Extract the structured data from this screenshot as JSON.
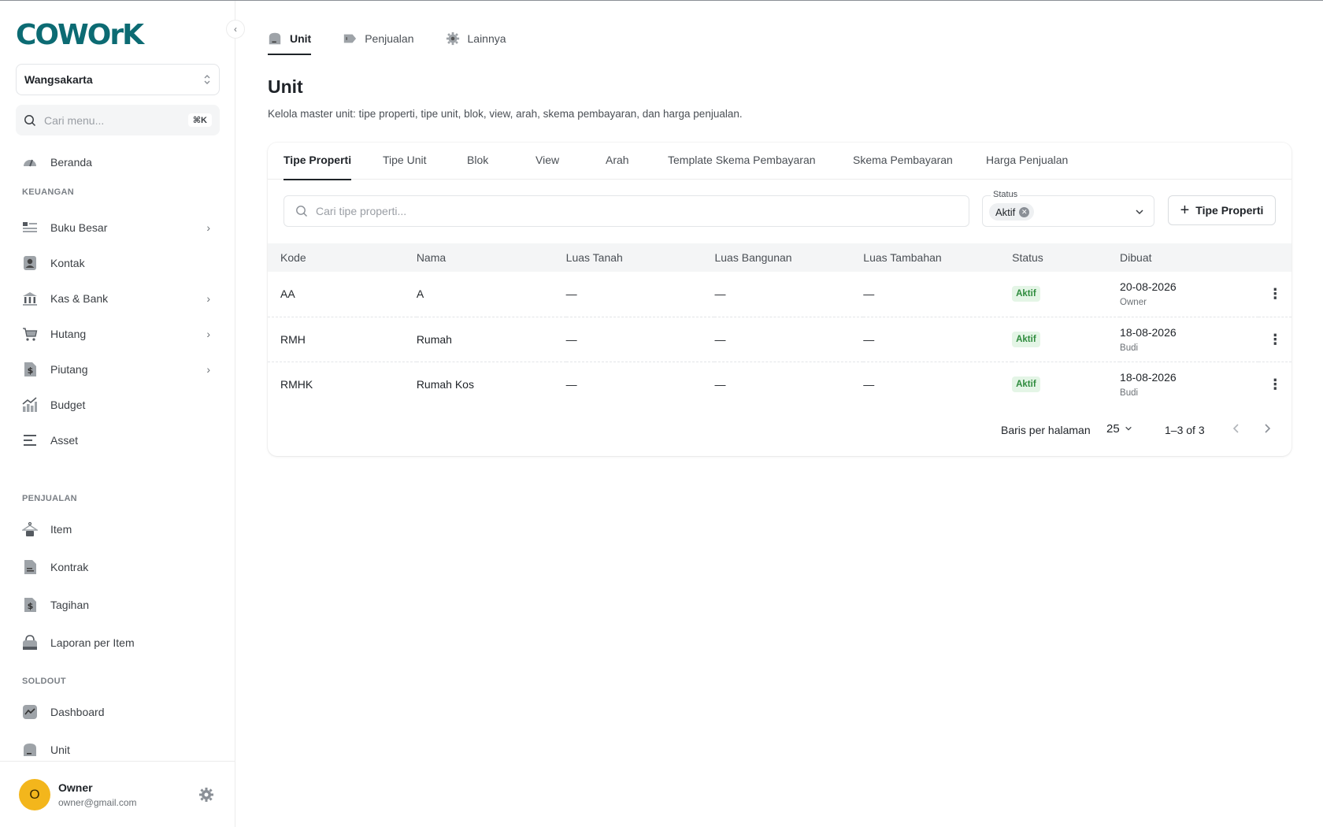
{
  "brand": {
    "logo_text": "COWOrK",
    "logo_color": "#0c6b73"
  },
  "sidebar": {
    "workspace": "Wangsakarta",
    "search_placeholder": "Cari menu...",
    "search_shortcut": "⌘K",
    "home": {
      "label": "Beranda",
      "icon": "dashboard-gauge-icon"
    },
    "sections": [
      {
        "title": "KEUANGAN"
      },
      {
        "title": "PENJUALAN"
      },
      {
        "title": "SOLDOUT"
      }
    ],
    "keuangan": [
      {
        "label": "Buku Besar",
        "icon": "ledger-icon",
        "expandable": true
      },
      {
        "label": "Kontak",
        "icon": "contact-icon",
        "expandable": false
      },
      {
        "label": "Kas & Bank",
        "icon": "bank-icon",
        "expandable": true
      },
      {
        "label": "Hutang",
        "icon": "cart-icon",
        "expandable": true
      },
      {
        "label": "Piutang",
        "icon": "receivable-icon",
        "expandable": true
      },
      {
        "label": "Budget",
        "icon": "budget-chart-icon",
        "expandable": false
      },
      {
        "label": "Asset",
        "icon": "asset-icon",
        "expandable": false
      }
    ],
    "penjualan": [
      {
        "label": "Item",
        "icon": "hanger-icon"
      },
      {
        "label": "Kontrak",
        "icon": "contract-icon"
      },
      {
        "label": "Tagihan",
        "icon": "invoice-icon"
      },
      {
        "label": "Laporan per Item",
        "icon": "bag-icon"
      }
    ],
    "soldout": [
      {
        "label": "Dashboard",
        "icon": "trend-icon"
      },
      {
        "label": "Unit",
        "icon": "unit-icon"
      }
    ],
    "user": {
      "initial": "O",
      "name": "Owner",
      "email": "owner@gmail.com",
      "avatar_color": "#f3b61c"
    }
  },
  "top_tabs": [
    {
      "label": "Unit",
      "icon": "unit-icon",
      "active": true
    },
    {
      "label": "Penjualan",
      "icon": "tag-icon",
      "active": false
    },
    {
      "label": "Lainnya",
      "icon": "gear-icon",
      "active": false
    }
  ],
  "page": {
    "title": "Unit",
    "description": "Kelola master unit: tipe properti, tipe unit, blok, view, arah, skema pembayaran, dan harga penjualan."
  },
  "sub_tabs": [
    {
      "label": "Tipe Properti",
      "active": true
    },
    {
      "label": "Tipe Unit"
    },
    {
      "label": "Blok"
    },
    {
      "label": "View"
    },
    {
      "label": "Arah"
    },
    {
      "label": "Template Skema Pembayaran"
    },
    {
      "label": "Skema Pembayaran"
    },
    {
      "label": "Harga Penjualan"
    }
  ],
  "filters": {
    "search_placeholder": "Cari tipe properti...",
    "status_label": "Status",
    "status_value": "Aktif",
    "add_button": "Tipe Properti"
  },
  "table": {
    "columns": [
      "Kode",
      "Nama",
      "Luas Tanah",
      "Luas Bangunan",
      "Luas Tambahan",
      "Status",
      "Dibuat"
    ],
    "rows": [
      {
        "kode": "AA",
        "nama": "A",
        "luas_tanah": "—",
        "luas_bangunan": "—",
        "luas_tambahan": "—",
        "status": "Aktif",
        "dibuat": "20-08-2026",
        "oleh": "Owner"
      },
      {
        "kode": "RMH",
        "nama": "Rumah",
        "luas_tanah": "—",
        "luas_bangunan": "—",
        "luas_tambahan": "—",
        "status": "Aktif",
        "dibuat": "18-08-2026",
        "oleh": "Budi"
      },
      {
        "kode": "RMHK",
        "nama": "Rumah Kos",
        "luas_tanah": "—",
        "luas_bangunan": "—",
        "luas_tambahan": "—",
        "status": "Aktif",
        "dibuat": "18-08-2026",
        "oleh": "Budi"
      }
    ]
  },
  "pagination": {
    "rows_label": "Baris per halaman",
    "rows_per_page": "25",
    "range": "1–3 of 3"
  },
  "colors": {
    "badge_bg": "#e4f5e6",
    "badge_text": "#2e8b3d"
  }
}
